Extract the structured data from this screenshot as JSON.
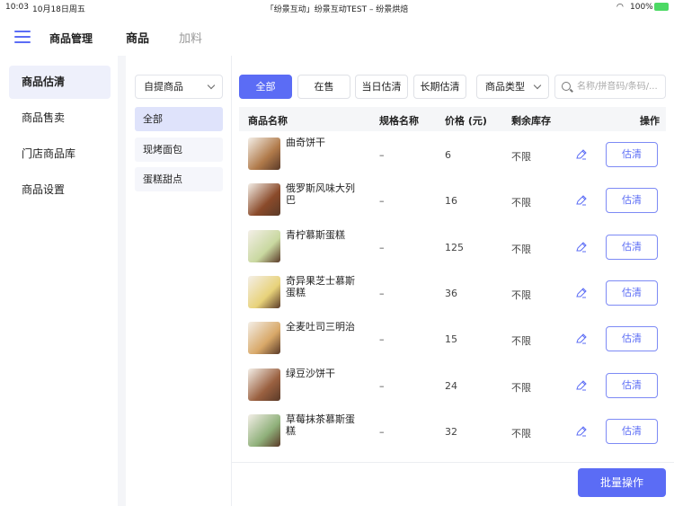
{
  "status": {
    "time": "10:03",
    "date": "10月18日周五",
    "title": "「纷景互动」纷景互动TEST – 纷景烘焙",
    "battery": "100%"
  },
  "header": {
    "title": "商品管理",
    "tabs": [
      "商品",
      "加料"
    ]
  },
  "sidebar": {
    "items": [
      "商品估清",
      "商品售卖",
      "门店商品库",
      "商品设置"
    ]
  },
  "category": {
    "dropdown": "自提商品",
    "items": [
      "全部",
      "现烤面包",
      "蛋糕甜点"
    ]
  },
  "filters": {
    "buttons": [
      "全部",
      "在售",
      "当日估清",
      "长期估清"
    ],
    "type_select": "商品类型",
    "search_placeholder": "名称/拼音码/条码/..."
  },
  "table": {
    "headers": [
      "商品名称",
      "规格名称",
      "价格 (元)",
      "剩余库存",
      "操作"
    ],
    "rows": [
      {
        "name": "曲奇饼干",
        "spec": "–",
        "price": "6",
        "stock": "不限",
        "action": "估清",
        "color": "#b07a4a"
      },
      {
        "name": "俄罗斯风味大列巴",
        "spec": "–",
        "price": "16",
        "stock": "不限",
        "action": "估清",
        "color": "#8a4a2a"
      },
      {
        "name": "青柠慕斯蛋糕",
        "spec": "–",
        "price": "125",
        "stock": "不限",
        "action": "估清",
        "color": "#c9d8a0"
      },
      {
        "name": "奇异果芝士慕斯蛋糕",
        "spec": "–",
        "price": "36",
        "stock": "不限",
        "action": "估清",
        "color": "#e8d27a"
      },
      {
        "name": "全麦吐司三明治",
        "spec": "–",
        "price": "15",
        "stock": "不限",
        "action": "估清",
        "color": "#d8a868"
      },
      {
        "name": "绿豆沙饼干",
        "spec": "–",
        "price": "24",
        "stock": "不限",
        "action": "估清",
        "color": "#9a6040"
      },
      {
        "name": "草莓抹茶慕斯蛋糕",
        "spec": "–",
        "price": "32",
        "stock": "不限",
        "action": "估清",
        "color": "#8fb07a"
      }
    ]
  },
  "footer": {
    "batch": "批量操作"
  },
  "colors": {
    "accent": "#5b6cf5"
  }
}
